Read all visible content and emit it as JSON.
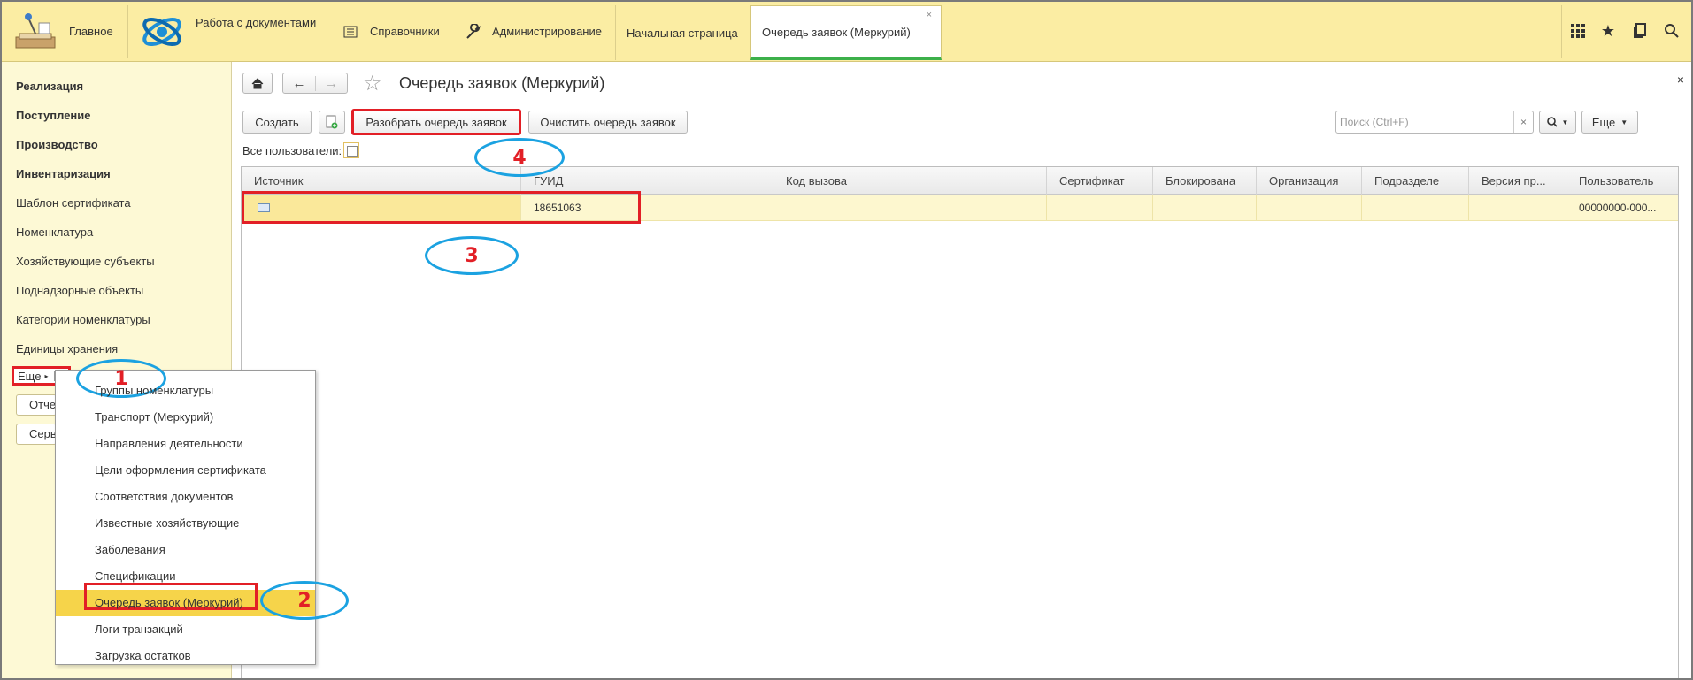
{
  "topbar": {
    "home_label": "Главное",
    "sections": [
      {
        "label": "Работа с документами",
        "icon": "orbit-logo-icon"
      },
      {
        "label": "Справочники",
        "icon": "list-icon"
      },
      {
        "label": "Администрирование",
        "icon": "wrench-icon"
      }
    ],
    "tabs": [
      {
        "label": "Начальная страница",
        "active": false
      },
      {
        "label": "Очередь заявок (Меркурий)",
        "active": true,
        "close": "×"
      }
    ],
    "right_icons": [
      "apps-grid-icon",
      "star-icon",
      "history-icon",
      "search-icon"
    ]
  },
  "sidebar": {
    "bold_items": [
      "Реализация",
      "Поступление",
      "Производство",
      "Инвентаризация"
    ],
    "items": [
      "Шаблон сертификата",
      "Номенклатура",
      "Хозяйствующие субъекты",
      "Поднадзорные объекты",
      "Категории номенклатуры",
      "Единицы хранения"
    ],
    "more_label": "Еще",
    "buttons": [
      "Отчеты",
      "Сервис"
    ]
  },
  "menu": {
    "items": [
      {
        "label": "Группы номенклатуры",
        "active": false
      },
      {
        "label": "Транспорт (Меркурий)",
        "active": false
      },
      {
        "label": "Направления деятельности",
        "active": false
      },
      {
        "label": "Цели оформления сертификата",
        "active": false
      },
      {
        "label": "Соответствия документов",
        "active": false
      },
      {
        "label": "Известные хозяйствующие",
        "active": false
      },
      {
        "label": "Заболевания",
        "active": false
      },
      {
        "label": "Спецификации",
        "active": false
      },
      {
        "label": "Очередь заявок (Меркурий)",
        "active": true
      },
      {
        "label": "Логи транзакций",
        "active": false
      },
      {
        "label": "Загрузка остатков",
        "active": false
      }
    ]
  },
  "main": {
    "title": "Очередь заявок (Меркурий)",
    "close": "×",
    "toolbar": {
      "create": "Создать",
      "parse_queue": "Разобрать очередь заявок",
      "clear_queue": "Очистить очередь заявок",
      "search_placeholder": "Поиск (Ctrl+F)",
      "search_clear": "×",
      "more": "Еще"
    },
    "filter_label": "Все пользователи:",
    "columns": [
      "Источник",
      "ГУИД",
      "Код вызова",
      "Сертификат",
      "Блокирована",
      "Организация",
      "Подразделе",
      "Версия пр...",
      "Пользователь"
    ],
    "rows": [
      [
        "",
        "18651063",
        "",
        "",
        "",
        "",
        "",
        "",
        "00000000-000..."
      ]
    ]
  },
  "annotations": [
    "1",
    "2",
    "3",
    "4"
  ],
  "colors": {
    "topbar_bg": "#fbeda3",
    "sidebar_bg": "#fdf9d5",
    "highlight_red": "#e21f26",
    "annotation_blue": "#1ba2e1",
    "active_tab_underline": "#3cb04a"
  }
}
